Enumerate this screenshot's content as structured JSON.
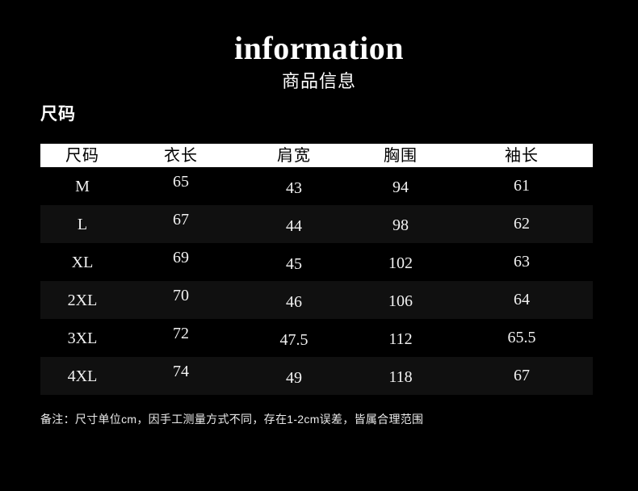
{
  "header": {
    "title_en": "information",
    "title_cn": "商品信息"
  },
  "section": {
    "heading": "尺码"
  },
  "table": {
    "columns": [
      "尺码",
      "衣长",
      "肩宽",
      "胸围",
      "袖长"
    ],
    "rows": [
      {
        "size": "M",
        "length": "65",
        "shoulder": "43",
        "chest": "94",
        "sleeve": "61"
      },
      {
        "size": "L",
        "length": "67",
        "shoulder": "44",
        "chest": "98",
        "sleeve": "62"
      },
      {
        "size": "XL",
        "length": "69",
        "shoulder": "45",
        "chest": "102",
        "sleeve": "63"
      },
      {
        "size": "2XL",
        "length": "70",
        "shoulder": "46",
        "chest": "106",
        "sleeve": "64"
      },
      {
        "size": "3XL",
        "length": "72",
        "shoulder": "47.5",
        "chest": "112",
        "sleeve": "65.5"
      },
      {
        "size": "4XL",
        "length": "74",
        "shoulder": "49",
        "chest": "118",
        "sleeve": "67"
      }
    ]
  },
  "footnote": {
    "text": "备注：尺寸单位cm，因手工测量方式不同，存在1-2cm误差，皆属合理范围"
  },
  "colors": {
    "background": "#000000",
    "header_band": "#ffffff",
    "header_text": "#000000",
    "stripe_row": "#101010",
    "body_text": "#f2f2f2"
  }
}
